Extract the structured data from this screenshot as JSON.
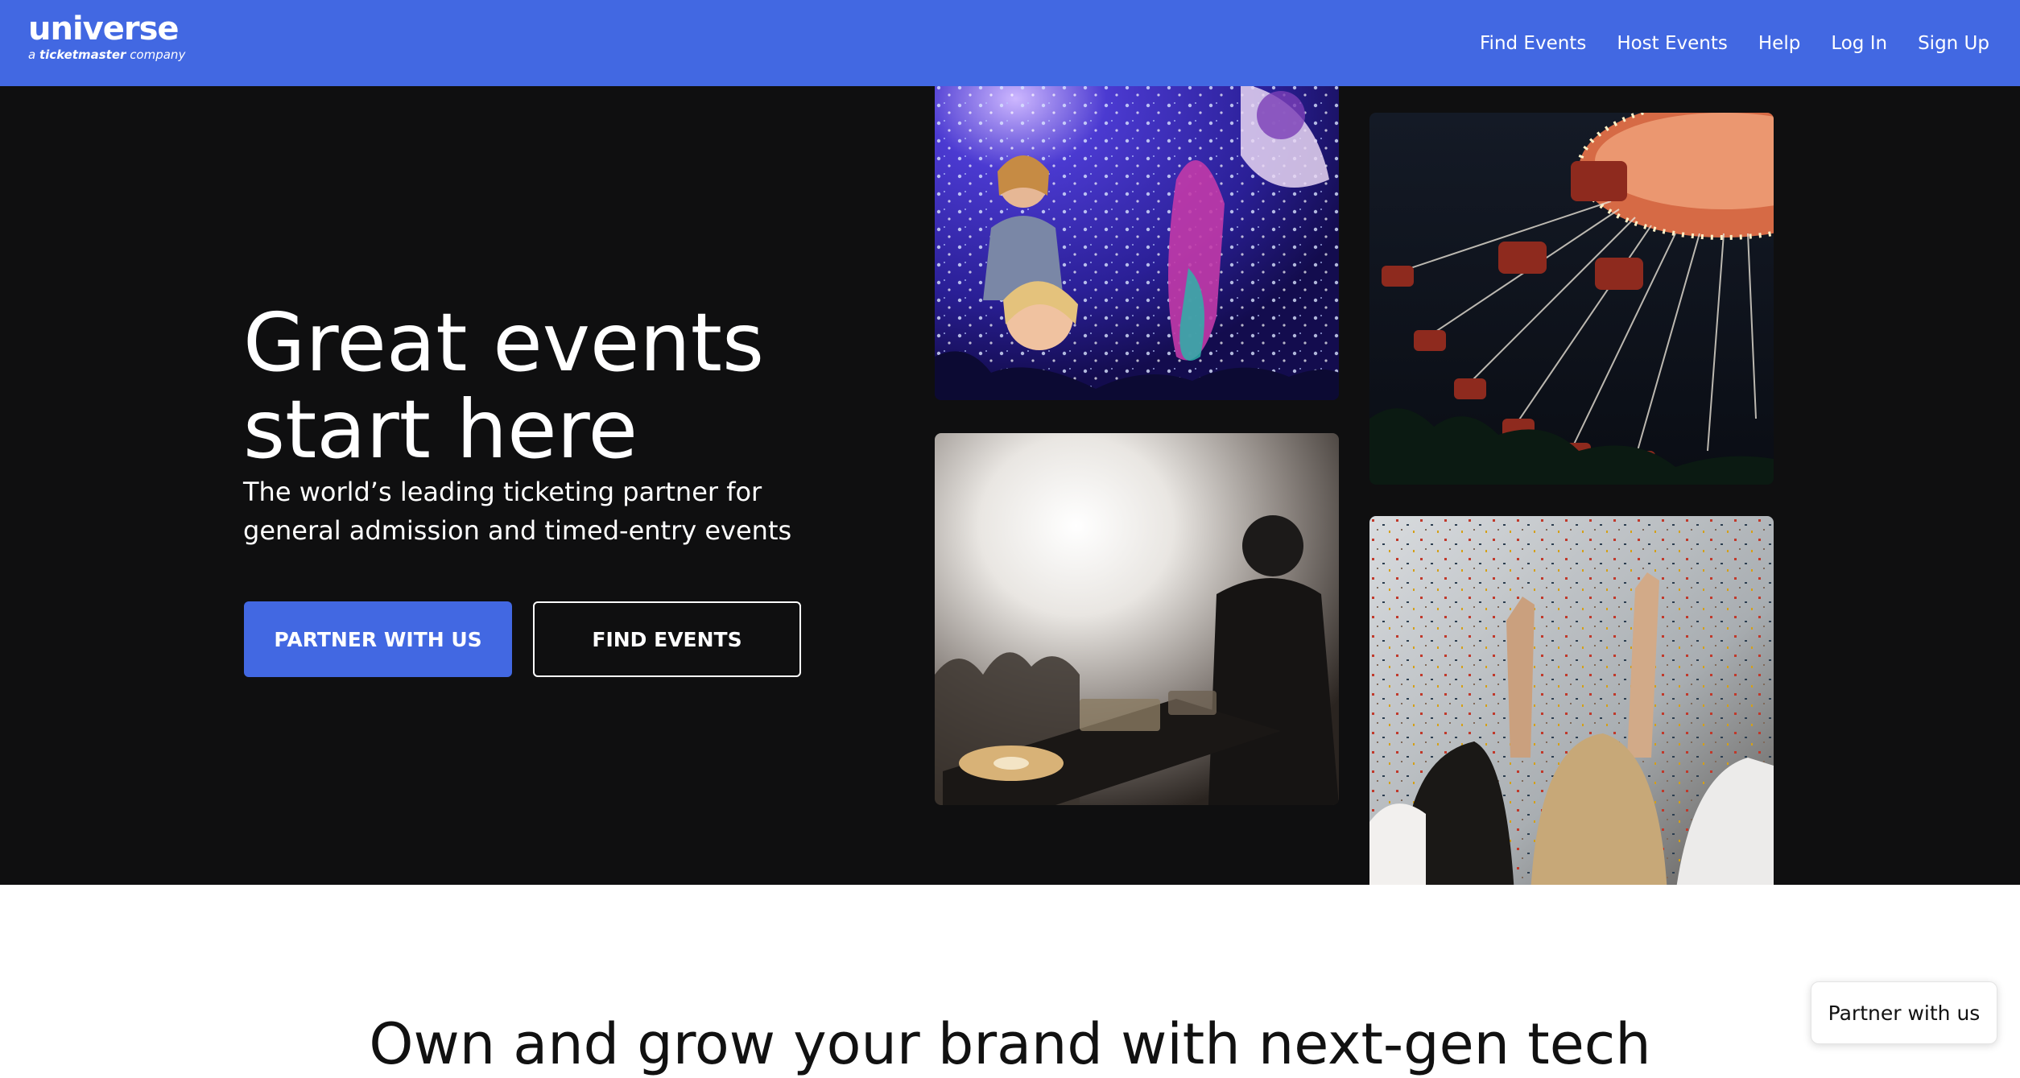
{
  "brand": {
    "name": "universe",
    "tagline_prefix": "a",
    "tagline_brand": "ticketmaster",
    "tagline_suffix": "company"
  },
  "nav": {
    "items": [
      {
        "label": "Find Events"
      },
      {
        "label": "Host Events"
      },
      {
        "label": "Help"
      },
      {
        "label": "Log In"
      },
      {
        "label": "Sign Up"
      }
    ]
  },
  "hero": {
    "title": "Great events start here",
    "subtitle": "The world’s leading ticketing partner for general admission and timed-entry events",
    "primary_button": "PARTNER WITH US",
    "secondary_button": "FIND EVENTS"
  },
  "section": {
    "heading": "Own and grow your brand with next-gen tech"
  },
  "floating_button": {
    "label": "Partner with us"
  },
  "colors": {
    "brand_blue": "#4268e2",
    "hero_background": "#0f0f10"
  }
}
